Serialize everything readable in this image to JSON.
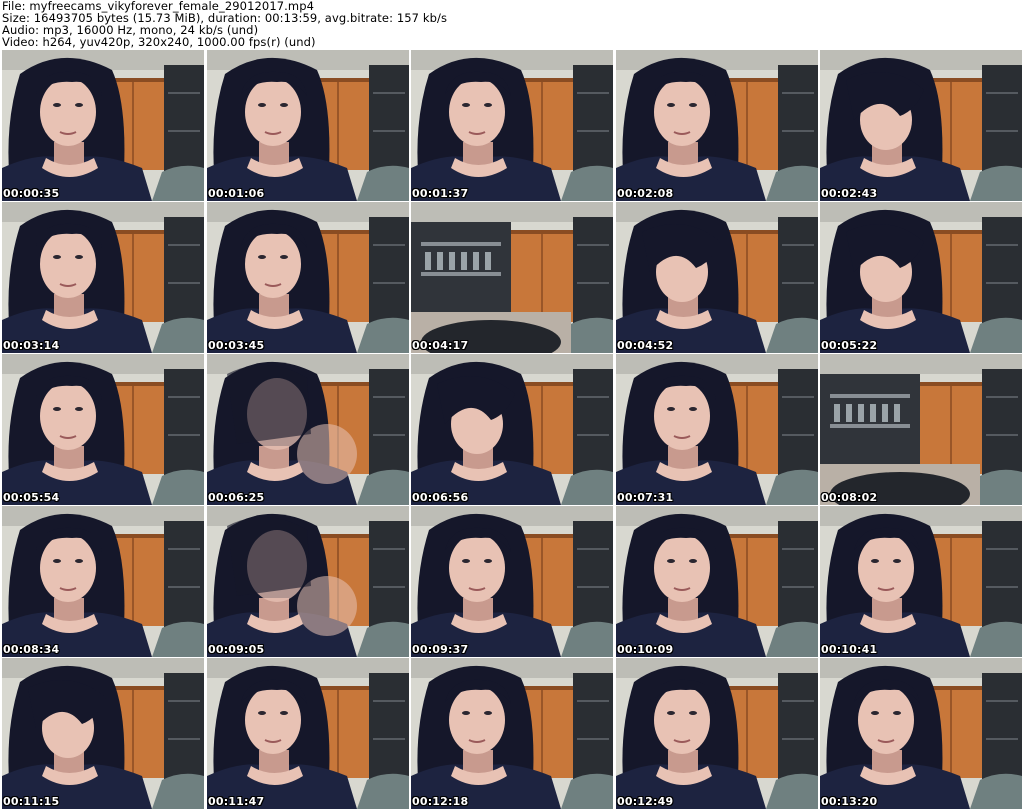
{
  "header": {
    "file_line": "File: myfreecams_vikyforever_female_29012017.mp4",
    "size_line": "Size: 16493705 bytes (15.73 MiB), duration: 00:13:59, avg.bitrate: 157 kb/s",
    "audio_line": "Audio: mp3, 16000 Hz, mono, 24 kb/s (und)",
    "video_line": "Video: h264, yuv420p, 320x240, 1000.00 fps(r) (und)"
  },
  "thumbnails": [
    {
      "timestamp": "00:00:35",
      "scene": "face"
    },
    {
      "timestamp": "00:01:06",
      "scene": "face"
    },
    {
      "timestamp": "00:01:37",
      "scene": "face"
    },
    {
      "timestamp": "00:02:08",
      "scene": "face"
    },
    {
      "timestamp": "00:02:43",
      "scene": "face-down"
    },
    {
      "timestamp": "00:03:14",
      "scene": "face"
    },
    {
      "timestamp": "00:03:45",
      "scene": "face"
    },
    {
      "timestamp": "00:04:17",
      "scene": "room"
    },
    {
      "timestamp": "00:04:52",
      "scene": "face-down"
    },
    {
      "timestamp": "00:05:22",
      "scene": "face-down"
    },
    {
      "timestamp": "00:05:54",
      "scene": "face"
    },
    {
      "timestamp": "00:06:25",
      "scene": "blur"
    },
    {
      "timestamp": "00:06:56",
      "scene": "face-down"
    },
    {
      "timestamp": "00:07:31",
      "scene": "face"
    },
    {
      "timestamp": "00:08:02",
      "scene": "room"
    },
    {
      "timestamp": "00:08:34",
      "scene": "face"
    },
    {
      "timestamp": "00:09:05",
      "scene": "blur"
    },
    {
      "timestamp": "00:09:37",
      "scene": "face"
    },
    {
      "timestamp": "00:10:09",
      "scene": "face"
    },
    {
      "timestamp": "00:10:41",
      "scene": "face"
    },
    {
      "timestamp": "00:11:15",
      "scene": "face-down"
    },
    {
      "timestamp": "00:11:47",
      "scene": "face"
    },
    {
      "timestamp": "00:12:18",
      "scene": "face"
    },
    {
      "timestamp": "00:12:49",
      "scene": "face"
    },
    {
      "timestamp": "00:13:20",
      "scene": "face"
    }
  ],
  "colors": {
    "wall": "#d8d8d0",
    "cabinet": "#c8773a",
    "cabinet_dark": "#8a4c22",
    "shelf": "#2a2e33",
    "chair": "#6f8080",
    "skin": "#e8c2b4",
    "skin_shadow": "#c89a8e",
    "hair": "#15172a",
    "top": "#1d2340",
    "timestamp_text": "#ffffff"
  }
}
